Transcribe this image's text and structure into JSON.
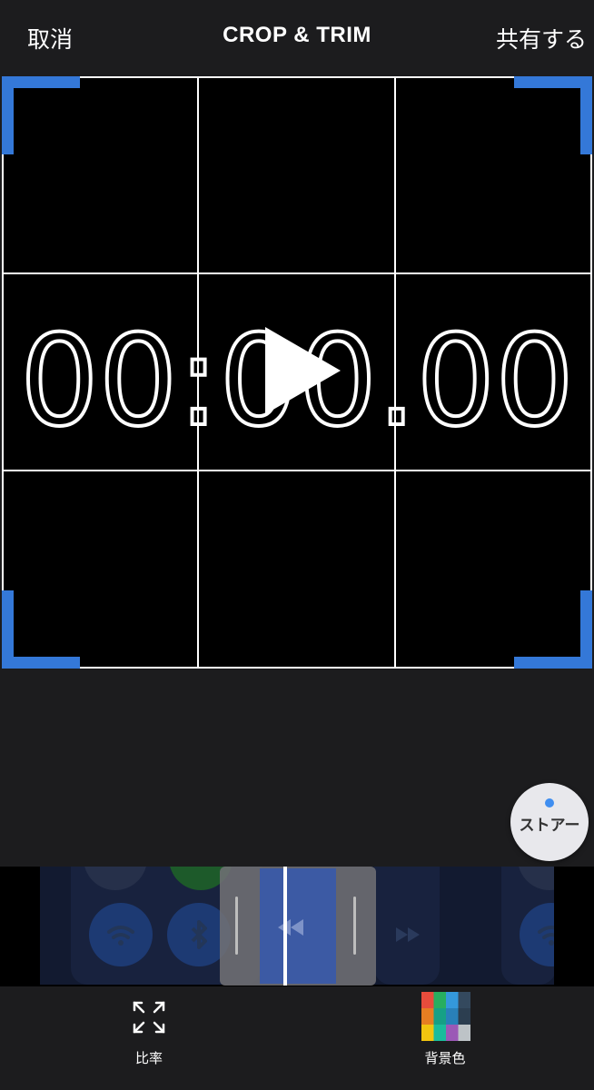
{
  "topbar": {
    "cancel_label": "取消",
    "title": "CROP & TRIM",
    "share_label": "共有する"
  },
  "preview": {
    "timer_text": "00:00.00",
    "play_icon": "play-icon",
    "crop_corner_color": "#3478d8"
  },
  "store_button": {
    "label": "ストアー",
    "badge_color": "#3f8ef0"
  },
  "timeline": {
    "filmstrip_icons": [
      "wifi-icon",
      "bluetooth-icon",
      "rewind-icon",
      "fast-forward-icon",
      "wifi-icon"
    ]
  },
  "tools": {
    "ratio_label": "比率",
    "ratio_icon": "expand-arrows-icon",
    "background_label": "背景色",
    "background_icon": "color-palette-icon"
  },
  "colors": {
    "background": "#1c1c1e",
    "accent": "#3478d8",
    "palette": [
      "#e74c3c",
      "#27ae60",
      "#3498db",
      "#34495e",
      "#e67e22",
      "#16a085",
      "#2980b9",
      "#2c3e50",
      "#f1c40f",
      "#1abc9c",
      "#9b59b6",
      "#bdc3c7"
    ]
  }
}
